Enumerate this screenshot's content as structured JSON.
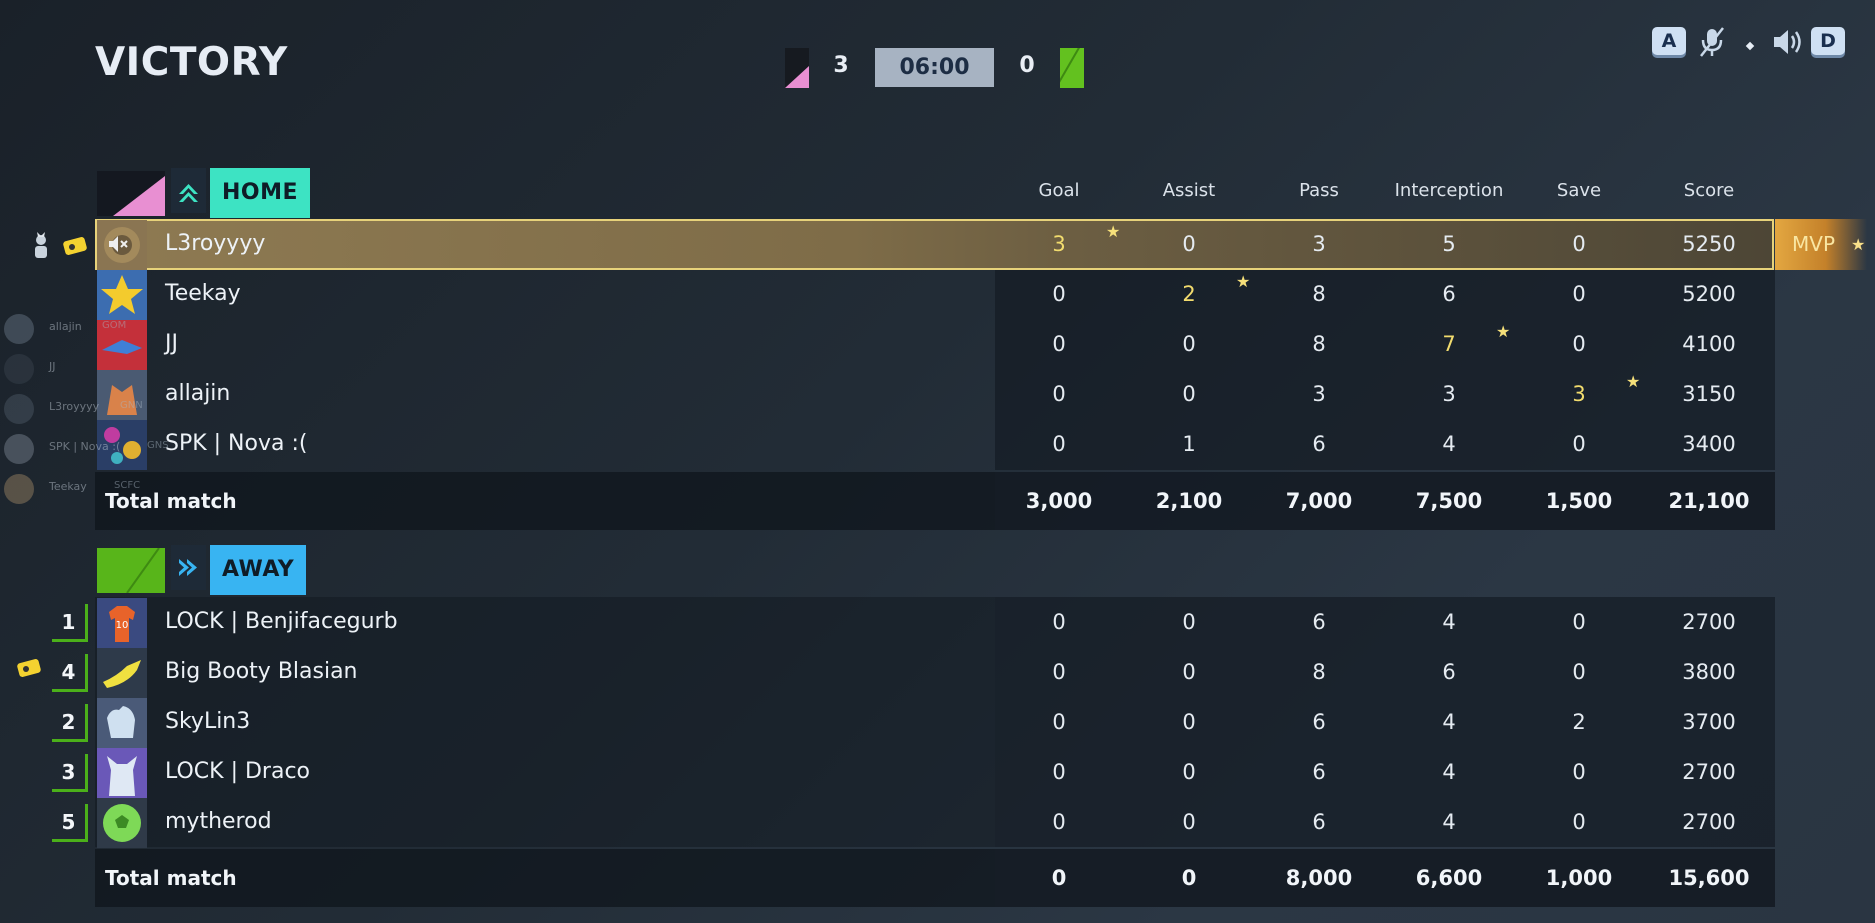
{
  "title": "VICTORY",
  "scoreboard": {
    "home_score": "3",
    "away_score": "0",
    "timer": "06:00"
  },
  "controls": {
    "key_left": "A",
    "key_right": "D",
    "icons": [
      "mic-muted-icon",
      "dot-icon",
      "speaker-icon"
    ]
  },
  "columns": [
    "Goal",
    "Assist",
    "Pass",
    "Interception",
    "Save",
    "Score"
  ],
  "home": {
    "label": "HOME",
    "color": "#3de3c3",
    "players": [
      {
        "name": "L3royyyy",
        "goal": "3",
        "assist": "0",
        "pass": "3",
        "interception": "5",
        "save": "0",
        "score": "5250"
      },
      {
        "name": "Teekay",
        "goal": "0",
        "assist": "2",
        "pass": "8",
        "interception": "6",
        "save": "0",
        "score": "5200"
      },
      {
        "name": "JJ",
        "goal": "0",
        "assist": "0",
        "pass": "8",
        "interception": "7",
        "save": "0",
        "score": "4100"
      },
      {
        "name": "allajin",
        "goal": "0",
        "assist": "0",
        "pass": "3",
        "interception": "3",
        "save": "3",
        "score": "3150"
      },
      {
        "name": "SPK | Nova :(",
        "goal": "0",
        "assist": "1",
        "pass": "6",
        "interception": "4",
        "save": "0",
        "score": "3400"
      }
    ],
    "total": {
      "label": "Total match",
      "goal": "3,000",
      "assist": "2,100",
      "pass": "7,000",
      "interception": "7,500",
      "save": "1,500",
      "score": "21,100"
    }
  },
  "away": {
    "label": "AWAY",
    "color": "#38b4f2",
    "players": [
      {
        "rank": "1",
        "name": "LOCK | Benjifacegurb",
        "goal": "0",
        "assist": "0",
        "pass": "6",
        "interception": "4",
        "save": "0",
        "score": "2700"
      },
      {
        "rank": "4",
        "name": "Big Booty Blasian",
        "goal": "0",
        "assist": "0",
        "pass": "8",
        "interception": "6",
        "save": "0",
        "score": "3800"
      },
      {
        "rank": "2",
        "name": "SkyLin3",
        "goal": "0",
        "assist": "0",
        "pass": "6",
        "interception": "4",
        "save": "2",
        "score": "3700"
      },
      {
        "rank": "3",
        "name": "LOCK | Draco",
        "goal": "0",
        "assist": "0",
        "pass": "6",
        "interception": "4",
        "save": "0",
        "score": "2700"
      },
      {
        "rank": "5",
        "name": "mytherod",
        "goal": "0",
        "assist": "0",
        "pass": "6",
        "interception": "4",
        "save": "0",
        "score": "2700"
      }
    ],
    "total": {
      "label": "Total match",
      "goal": "0",
      "assist": "0",
      "pass": "8,000",
      "interception": "6,600",
      "save": "1,000",
      "score": "15,600"
    }
  },
  "mvp_label": "MVP",
  "ghost_list": [
    {
      "name": "allajin",
      "tag": "GOM"
    },
    {
      "name": "JJ",
      "tag": ""
    },
    {
      "name": "L3royyyy",
      "tag": "GNN"
    },
    {
      "name": "SPK | Nova :(",
      "tag": "GNS"
    },
    {
      "name": "Teekay",
      "tag": "SCFC"
    }
  ]
}
